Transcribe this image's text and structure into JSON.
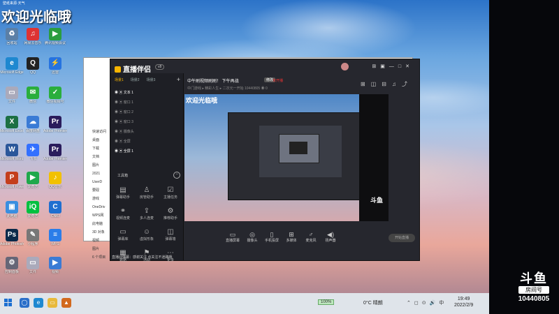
{
  "desktop": {
    "top_tiny_text": "壁纸来源·天气",
    "welcome_text": "欢迎光临哦",
    "icons": [
      {
        "label": "回收站",
        "glyph": "♻",
        "color": "#5b7fa6"
      },
      {
        "label": "网易云音乐",
        "glyph": "♫",
        "color": "#d33"
      },
      {
        "label": "腾讯视频会议",
        "glyph": "▶",
        "color": "#2a9d3f"
      },
      {
        "label": "Microsoft Edge",
        "glyph": "e",
        "color": "#1e88d0"
      },
      {
        "label": "QQ",
        "glyph": "Q",
        "color": "#222"
      },
      {
        "label": "迅雷",
        "glyph": "⚡",
        "color": "#2673e0"
      },
      {
        "label": "文件",
        "glyph": "▭",
        "color": "#aab"
      },
      {
        "label": "微信",
        "glyph": "✉",
        "color": "#2aae3d"
      },
      {
        "label": "微信视频号",
        "glyph": "✓",
        "color": "#2aae3d"
      },
      {
        "label": "Microsoft Excel 2016",
        "glyph": "X",
        "color": "#1d7044"
      },
      {
        "label": "百度网盘",
        "glyph": "☁",
        "color": "#3a7bd5"
      },
      {
        "label": "Adobe Premiere",
        "glyph": "Pr",
        "color": "#2a1c5c"
      },
      {
        "label": "Microsoft Word 2016",
        "glyph": "W",
        "color": "#2b579a"
      },
      {
        "label": "飞书",
        "glyph": "✈",
        "color": "#3370ff"
      },
      {
        "label": "Adobe Premiere",
        "glyph": "Pr",
        "color": "#2a1c5c"
      },
      {
        "label": "Microsoft PowerPoint",
        "glyph": "P",
        "color": "#c43e1c"
      },
      {
        "label": "爱奇艺",
        "glyph": "▶",
        "color": "#1fa84b"
      },
      {
        "label": "QQ音乐",
        "glyph": "♪",
        "color": "#f2c100"
      },
      {
        "label": "此电脑",
        "glyph": "▣",
        "color": "#3a8ee0"
      },
      {
        "label": "爱奇艺",
        "glyph": "iQ",
        "color": "#00c040"
      },
      {
        "label": "CNKI",
        "glyph": "C",
        "color": "#1f6fd0"
      },
      {
        "label": "Adobe Photoshop",
        "glyph": "Ps",
        "color": "#0a2a4a"
      },
      {
        "label": "小程序",
        "glyph": "✎",
        "color": "#777"
      },
      {
        "label": "WPS",
        "glyph": "≡",
        "color": "#2b7de9"
      },
      {
        "label": "控制面板",
        "glyph": "⚙",
        "color": "#667"
      },
      {
        "label": "文件",
        "glyph": "▭",
        "color": "#aab"
      },
      {
        "label": "视频",
        "glyph": "▶",
        "color": "#3a7bd5"
      }
    ]
  },
  "explorer": {
    "sidebar_items": [
      "快速访问",
      "桌面",
      "下载",
      "文档",
      "图片",
      "2021",
      "UserD",
      "要砚",
      "游戏",
      "OneDriv",
      "WPS网",
      "此电脑",
      "3D 对象",
      "视频",
      "图片",
      "6 个项目"
    ]
  },
  "app": {
    "title": "直播伴侣",
    "version": "v8",
    "window_controls": [
      "⊞",
      "▣",
      "—",
      "□",
      "✕"
    ],
    "left_tabs": [
      {
        "label": "场景1",
        "active": true
      },
      {
        "label": "场景2",
        "active": false
      },
      {
        "label": "场景3",
        "active": false
      }
    ],
    "scenes": [
      {
        "label": "文本 1",
        "selected": true
      },
      {
        "label": "窗口 1",
        "selected": false
      },
      {
        "label": "窗口 2",
        "selected": false
      },
      {
        "label": "窗口 3",
        "selected": false
      },
      {
        "label": "摄像头",
        "selected": false
      },
      {
        "label": "全屏",
        "selected": false
      },
      {
        "label": "全屏 1",
        "selected": true
      }
    ],
    "toolbox_title": "工具箱",
    "tools": [
      {
        "label": "弹幕助手",
        "glyph": "▤"
      },
      {
        "label": "房管助手",
        "glyph": "♙"
      },
      {
        "label": "主播任务",
        "glyph": "☑"
      },
      {
        "label": "视频连麦",
        "glyph": "⚭"
      },
      {
        "label": "多人连麦",
        "glyph": "⇪"
      },
      {
        "label": "推荐助手",
        "glyph": "⚙"
      },
      {
        "label": "弹幕库",
        "glyph": "▭"
      },
      {
        "label": "虚拟形象",
        "glyph": "☺"
      },
      {
        "label": "弹幕墙",
        "glyph": "◫"
      },
      {
        "label": "数据",
        "glyph": "▦"
      },
      {
        "label": "活动",
        "glyph": "⚑"
      },
      {
        "label": "更多",
        "glyph": "⋯"
      }
    ],
    "live_title": "中午刷视频刷刷！ 下午再战",
    "live_badge": "修改",
    "live_status": "未开播",
    "live_subinfo": "中门游戏  ▸ 精彩人生  ▸  二次元一开始  10440805  ◉ 0",
    "top_icons": [
      "⊞",
      "◫",
      "⊟",
      "♫",
      "⤴"
    ],
    "preview": {
      "welcome": "欢迎光临哦",
      "logo": "斗鱼"
    },
    "bottom_tools": [
      {
        "label": "直播屏幕",
        "glyph": "▭"
      },
      {
        "label": "摄像头",
        "glyph": "◎"
      },
      {
        "label": "手机投屏",
        "glyph": "▯"
      },
      {
        "label": "多媒体",
        "glyph": "⊞"
      },
      {
        "label": "麦克风",
        "glyph": "♂"
      },
      {
        "label": "扬声器",
        "glyph": "◀)"
      }
    ],
    "start_live_label": "开始直播",
    "chat_line": "直播间弹幕：感谢关注 点关注不迷路哦"
  },
  "taskbar": {
    "badge": "100%",
    "weather": "0°C 晴朗",
    "tray_icons": [
      "⌃",
      "◻",
      "⊙",
      "🔊",
      "中"
    ],
    "time": "19:49",
    "date": "2022/2/9"
  },
  "watermark": {
    "logo": "斗鱼",
    "sub": "房间号",
    "room_id": "10440805"
  }
}
